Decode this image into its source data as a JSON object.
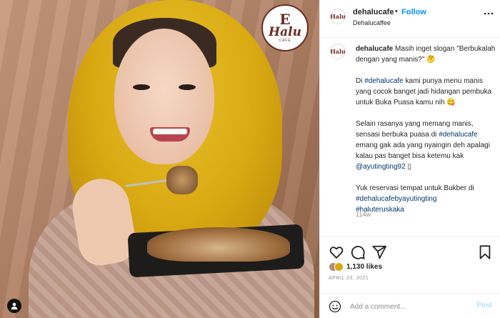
{
  "media": {
    "logo": {
      "mark": "E",
      "word": "Halu",
      "sub": "CAFE"
    }
  },
  "header": {
    "username": "dehalucafe",
    "separator": "•",
    "follow_label": "Follow",
    "subtitle": "Dehalucaffee"
  },
  "caption": {
    "username": "dehalucafe",
    "line1": "Masih inget slogan \"Berbukalah dengan yang manis?\" 🤔",
    "para2a": "Di ",
    "tag1": "#dehalucafe",
    "para2b": " kami punya menu manis yang cocok banget jadi hidangan pembuka untuk Buka Puasa kamu nih 😋",
    "para3a": "Selain rasanya yang memang manis, sensasi berbuka puasa di ",
    "tag2": "#dehalucafe",
    "para3b": " emang gak ada yang nyaingin deh apalagi kalau pas banget bisa ketemu kak ",
    "mention": "@ayutingting92",
    "para3c": " ▯",
    "para4": "Yuk reservasi tempat untuk Bukber di ",
    "tag3": "#dehalucafebyayutingting",
    "tag4": "#haluteruskaka",
    "time": "114w"
  },
  "footer": {
    "likes_count": "1,130 likes",
    "date": "APRIL 23, 2021",
    "comment_placeholder": "Add a comment...",
    "post_label": "Post"
  },
  "colors": {
    "accent": "#0095f6",
    "hashtag": "#00376b",
    "muted": "#8e8e8e",
    "brand": "#6b2b22"
  },
  "icons": [
    "heart-icon",
    "comment-icon",
    "share-icon",
    "bookmark-icon",
    "more-options-icon",
    "emoji-icon",
    "user-tag-icon"
  ]
}
